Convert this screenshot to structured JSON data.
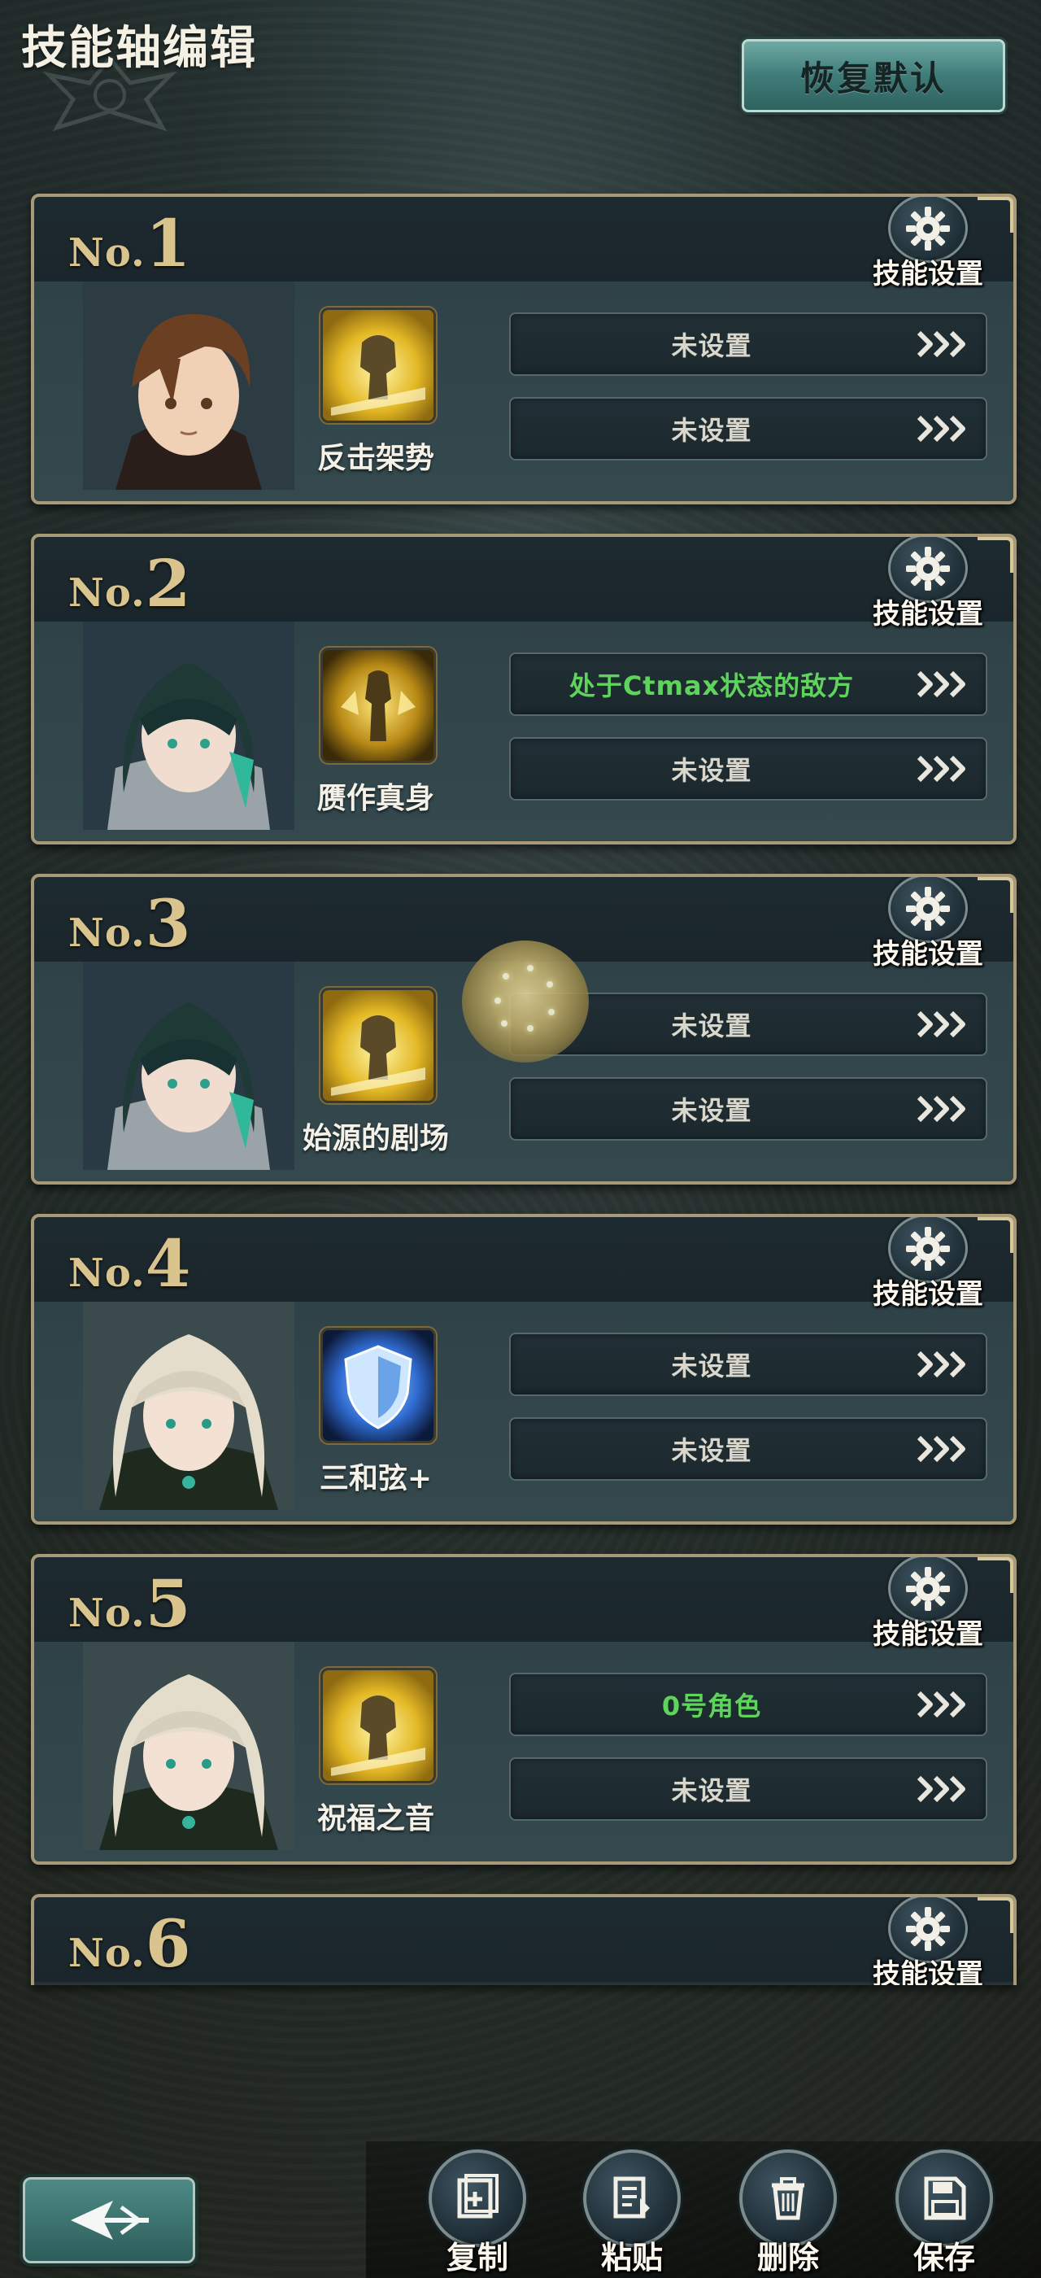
{
  "header": {
    "title": "技能轴编辑",
    "restore_label": "恢复默认"
  },
  "cards": [
    {
      "no_prefix": "No.",
      "no": "1",
      "settings_label": "技能设置",
      "skill_name": "反击架势",
      "slot1": "未设置",
      "slot2": "未设置"
    },
    {
      "no_prefix": "No.",
      "no": "2",
      "settings_label": "技能设置",
      "skill_name": "赝作真身",
      "slot1": "处于Ctmax状态的敌方",
      "slot2": "未设置"
    },
    {
      "no_prefix": "No.",
      "no": "3",
      "settings_label": "技能设置",
      "skill_name": "始源的剧场",
      "slot1": "未设置",
      "slot2": "未设置"
    },
    {
      "no_prefix": "No.",
      "no": "4",
      "settings_label": "技能设置",
      "skill_name": "三和弦+",
      "slot1": "未设置",
      "slot2": "未设置"
    },
    {
      "no_prefix": "No.",
      "no": "5",
      "settings_label": "技能设置",
      "skill_name": "祝福之音",
      "slot1": "0号角色",
      "slot2": "未设置"
    },
    {
      "no_prefix": "No.",
      "no": "6",
      "settings_label": "技能设置"
    }
  ],
  "actions": {
    "copy": "复制",
    "paste": "粘贴",
    "delete": "删除",
    "save": "保存"
  },
  "colors": {
    "accent_gold": "#d9c48e",
    "accent_teal": "#3f7c79",
    "highlight_green": "#5fd45c"
  }
}
